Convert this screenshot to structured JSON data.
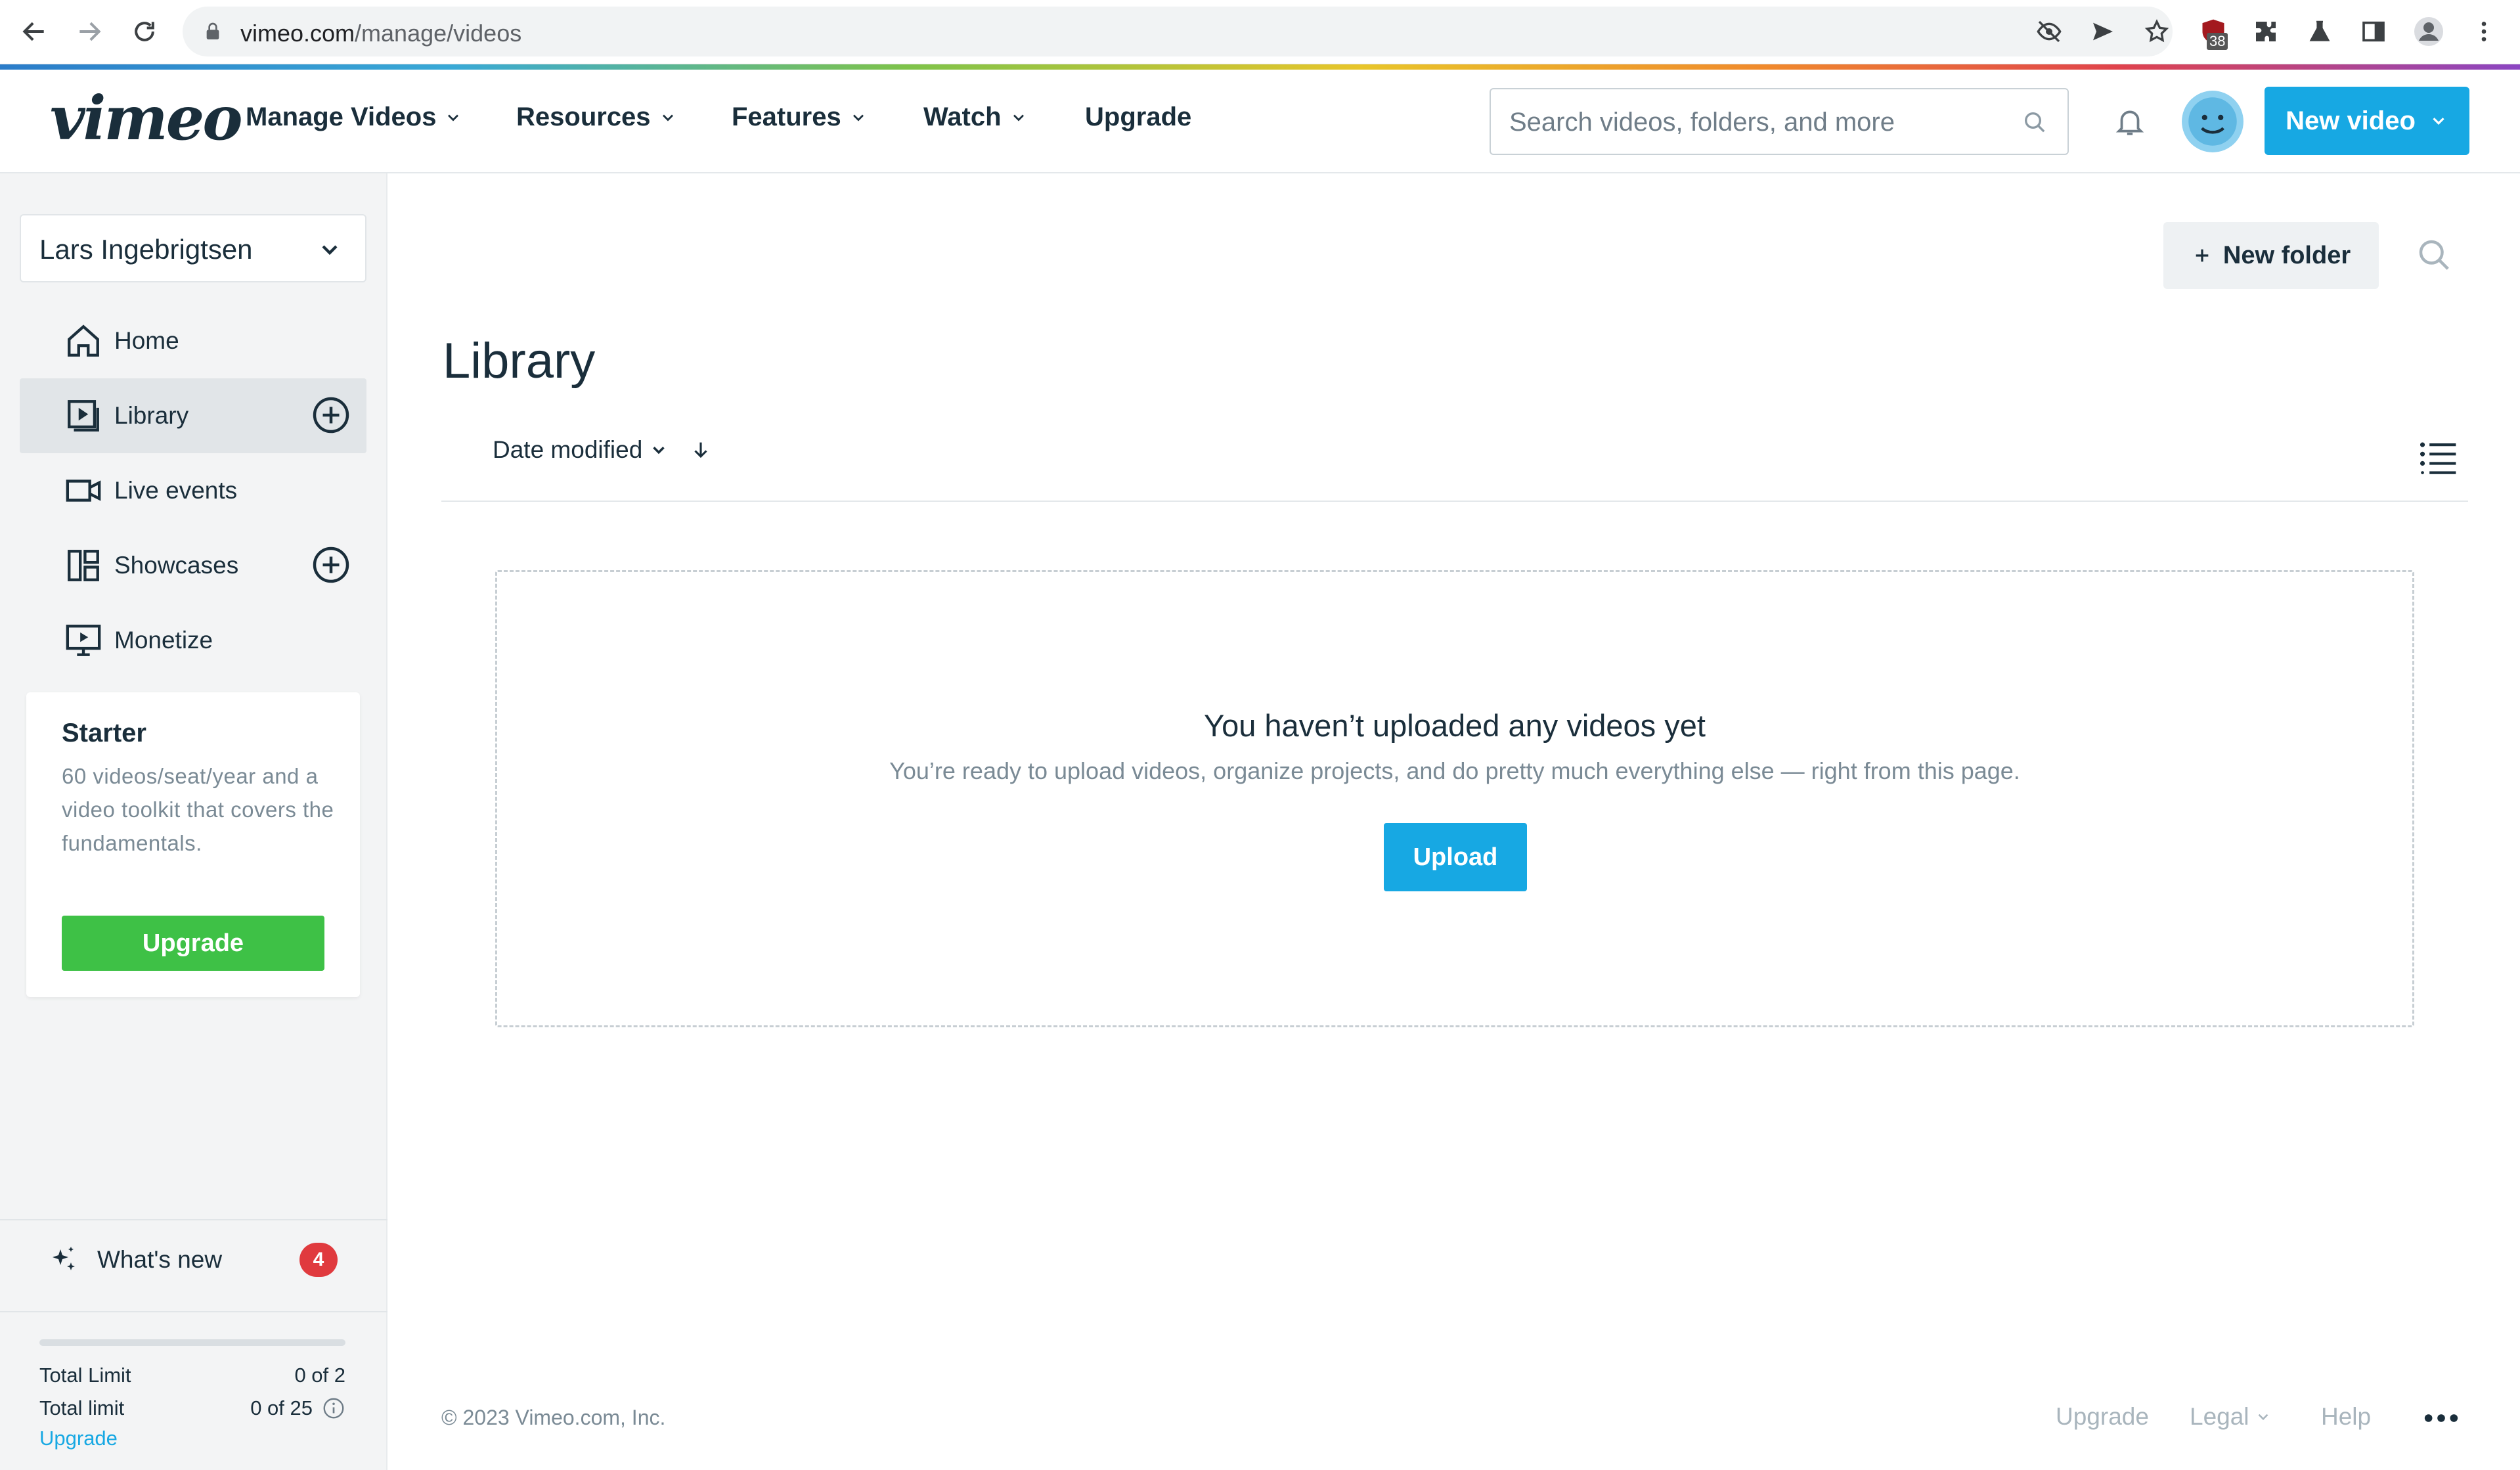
{
  "browser": {
    "url_domain": "vimeo.com",
    "url_path": "/manage/videos",
    "extension_badge": "38"
  },
  "header": {
    "logo": "vimeo",
    "nav": [
      "Manage Videos",
      "Resources",
      "Features",
      "Watch",
      "Upgrade"
    ],
    "search_placeholder": "Search videos, folders, and more",
    "new_video_label": "New video"
  },
  "sidebar": {
    "team_name": "Lars Ingebrigtsen",
    "items": [
      {
        "label": "Home"
      },
      {
        "label": "Library"
      },
      {
        "label": "Live events"
      },
      {
        "label": "Showcases"
      },
      {
        "label": "Monetize"
      }
    ],
    "starter": {
      "title": "Starter",
      "description": "60 videos/seat/year and a video toolkit that covers the fundamentals.",
      "button": "Upgrade"
    },
    "whats_new": "What's new",
    "whats_new_count": "4",
    "limits": [
      {
        "label": "Total Limit",
        "value": "0 of 2"
      },
      {
        "label": "Total limit",
        "value": "0 of 25"
      }
    ],
    "limit_progress": 0,
    "upgrade_link": "Upgrade"
  },
  "main": {
    "title": "Library",
    "new_folder_label": "New folder",
    "sort_label": "Date modified",
    "empty_title": "You haven’t uploaded any videos yet",
    "empty_description": "You’re ready to upload videos, organize projects, and do pretty much everything else — right from this page.",
    "upload_label": "Upload"
  },
  "footer": {
    "copyright": "© 2023 Vimeo.com, Inc.",
    "links": [
      "Upgrade",
      "Legal",
      "Help"
    ]
  },
  "colors": {
    "accent": "#17a8e3",
    "upgrade_green": "#3ec146",
    "badge_red": "#e03a3e",
    "text_dark": "#1a2e3b"
  }
}
